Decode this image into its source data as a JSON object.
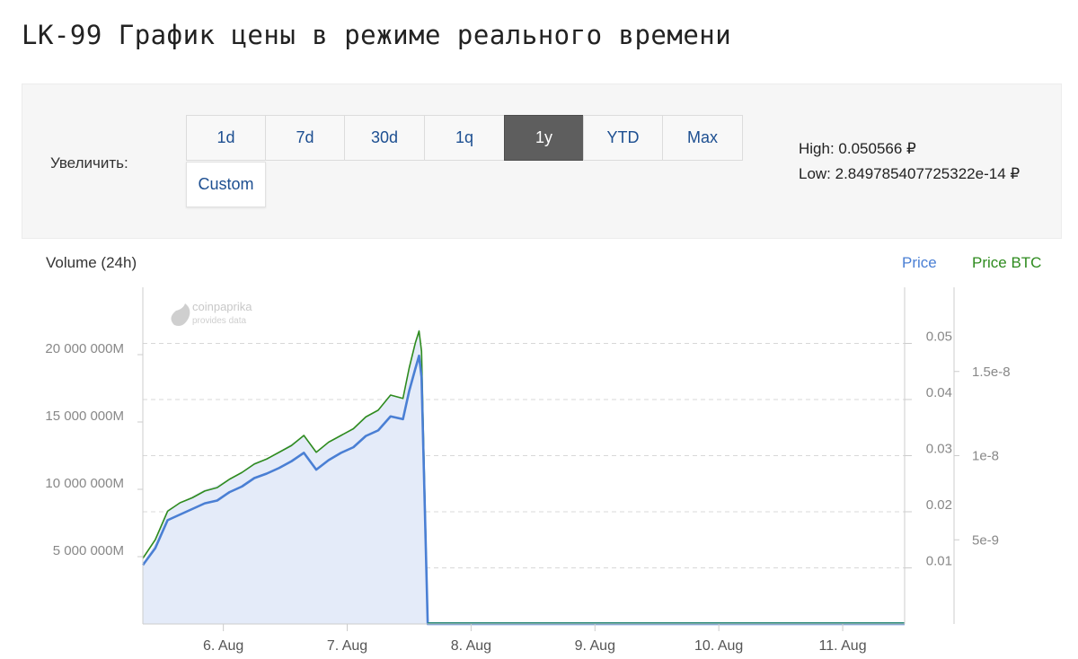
{
  "page": {
    "title": "LK-99 График цены в режиме реального времени"
  },
  "toolbar": {
    "zoom_label": "Увеличить:",
    "buttons": [
      {
        "label": "1d",
        "active": false
      },
      {
        "label": "7d",
        "active": false
      },
      {
        "label": "30d",
        "active": false
      },
      {
        "label": "1q",
        "active": false
      },
      {
        "label": "1y",
        "active": true
      },
      {
        "label": "YTD",
        "active": false
      },
      {
        "label": "Max",
        "active": false
      },
      {
        "label": "Custom",
        "active": false
      }
    ],
    "high_text": "High: 0.050566 ₽",
    "low_text": "Low: 2.849785407725322e-14 ₽"
  },
  "chart": {
    "volume_label": "Volume (24h)",
    "price_label": "Price",
    "price_btc_label": "Price BTC",
    "watermark_line1": "coinpaprika",
    "watermark_line2": "provides data",
    "colors": {
      "price": "#4a7fd4",
      "price_btc": "#2e8b1e",
      "volume_fill": "#e4ebf9",
      "grid": "#d8d8d8",
      "axis_text": "#888888"
    }
  },
  "chart_data": {
    "type": "line",
    "x_tick_labels": [
      "6. Aug",
      "7. Aug",
      "8. Aug",
      "9. Aug",
      "10. Aug",
      "11. Aug"
    ],
    "x_range_days": [
      5.35,
      11.5
    ],
    "y_left": {
      "label": "Volume (24h)",
      "tick_labels": [
        "5 000 000M",
        "10 000 000M",
        "15 000 000M",
        "20 000 000M"
      ],
      "ticks": [
        5000000,
        10000000,
        15000000,
        20000000
      ],
      "range": [
        0,
        25000000
      ]
    },
    "y_right_price": {
      "label": "Price",
      "tick_labels": [
        "0.01",
        "0.02",
        "0.03",
        "0.04",
        "0.05"
      ],
      "ticks": [
        0.01,
        0.02,
        0.03,
        0.04,
        0.05
      ],
      "range": [
        0,
        0.06
      ]
    },
    "y_right_btc": {
      "label": "Price BTC",
      "tick_labels": [
        "5e-9",
        "1e-8",
        "1.5e-8"
      ],
      "ticks": [
        5e-09,
        1e-08,
        1.5e-08
      ],
      "range": [
        0,
        2e-08
      ]
    },
    "series": [
      {
        "name": "Price",
        "axis": "price",
        "x": [
          5.35,
          5.45,
          5.55,
          5.65,
          5.75,
          5.85,
          5.95,
          6.05,
          6.15,
          6.25,
          6.35,
          6.45,
          6.55,
          6.65,
          6.75,
          6.85,
          6.95,
          7.05,
          7.15,
          7.25,
          7.35,
          7.45,
          7.5,
          7.55,
          7.58,
          7.6,
          7.65,
          8.0,
          9.0,
          10.0,
          11.0,
          11.5
        ],
        "y": [
          0.0105,
          0.0135,
          0.0185,
          0.0195,
          0.0205,
          0.0215,
          0.022,
          0.0235,
          0.0245,
          0.026,
          0.0268,
          0.0278,
          0.029,
          0.0305,
          0.0275,
          0.0292,
          0.0305,
          0.0315,
          0.0335,
          0.0345,
          0.037,
          0.0365,
          0.0415,
          0.0455,
          0.0478,
          0.044,
          0.0,
          0.0,
          0.0,
          0.0,
          0.0,
          0.0
        ]
      },
      {
        "name": "Price BTC",
        "axis": "btc",
        "x": [
          5.35,
          5.45,
          5.55,
          5.65,
          5.75,
          5.85,
          5.95,
          6.05,
          6.15,
          6.25,
          6.35,
          6.45,
          6.55,
          6.65,
          6.75,
          6.85,
          6.95,
          7.05,
          7.15,
          7.25,
          7.35,
          7.45,
          7.5,
          7.55,
          7.58,
          7.6,
          7.65,
          8.0,
          9.0,
          10.0,
          11.0,
          11.5
        ],
        "y": [
          3.9e-09,
          5e-09,
          6.7e-09,
          7.2e-09,
          7.5e-09,
          7.9e-09,
          8.1e-09,
          8.6e-09,
          9e-09,
          9.5e-09,
          9.8e-09,
          1.02e-08,
          1.06e-08,
          1.12e-08,
          1.02e-08,
          1.08e-08,
          1.12e-08,
          1.16e-08,
          1.23e-08,
          1.27e-08,
          1.36e-08,
          1.34e-08,
          1.52e-08,
          1.67e-08,
          1.74e-08,
          1.62e-08,
          0.0,
          0.0,
          0.0,
          0.0,
          0.0,
          0.0
        ]
      },
      {
        "name": "Volume (24h)",
        "axis": "volume",
        "x": [
          5.35,
          5.45,
          5.55,
          5.65,
          5.75,
          5.85,
          5.95,
          6.05,
          6.15,
          6.25,
          6.35,
          6.45,
          6.55,
          6.65,
          6.75,
          6.85,
          6.95,
          7.05,
          7.15,
          7.25,
          7.35,
          7.45,
          7.5,
          7.55,
          7.58,
          7.6,
          7.65
        ],
        "y": [
          4500000,
          6000000,
          8500000,
          9000000,
          9500000,
          10000000,
          10300000,
          10800000,
          11300000,
          12000000,
          12300000,
          12800000,
          13400000,
          14000000,
          12700000,
          13400000,
          14000000,
          14500000,
          15400000,
          15900000,
          17000000,
          16800000,
          19100000,
          20900000,
          22000000,
          20200000,
          0
        ]
      }
    ]
  }
}
